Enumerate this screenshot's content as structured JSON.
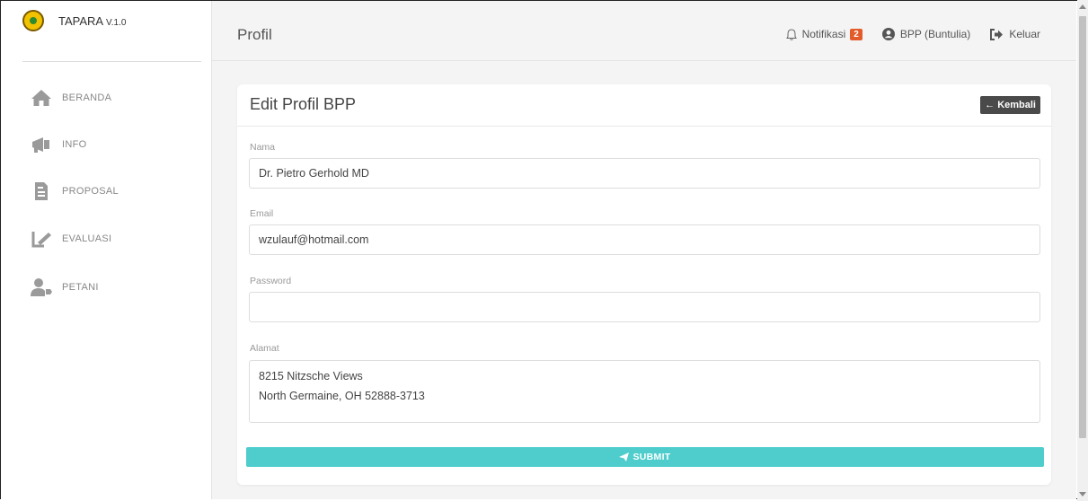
{
  "app": {
    "name": "TAPARA",
    "version": "V.1.0"
  },
  "sidebar": {
    "items": [
      {
        "label": "BERANDA",
        "icon": "home-icon"
      },
      {
        "label": "INFO",
        "icon": "megaphone-icon"
      },
      {
        "label": "PROPOSAL",
        "icon": "document-icon"
      },
      {
        "label": "EVALUASI",
        "icon": "signature-icon"
      },
      {
        "label": "PETANI",
        "icon": "user-tag-icon"
      }
    ]
  },
  "header": {
    "title": "Profil",
    "notifications_label": "Notifikasi",
    "notifications_count": "2",
    "user_label": "BPP (Buntulia)",
    "logout_label": "Keluar"
  },
  "card": {
    "title": "Edit Profil BPP",
    "back_label": "← Kembali"
  },
  "form": {
    "name_label": "Nama",
    "name_value": "Dr. Pietro Gerhold MD",
    "email_label": "Email",
    "email_value": "wzulauf@hotmail.com",
    "password_label": "Password",
    "password_value": "",
    "address_label": "Alamat",
    "address_line1": "8215 Nitzsche Views",
    "address_line2": "North Germaine, OH 52888-3713",
    "submit_label": "SUBMIT"
  },
  "colors": {
    "accent": "#4ecdcc",
    "badge": "#e35b2b",
    "logo": "#f2c200"
  }
}
